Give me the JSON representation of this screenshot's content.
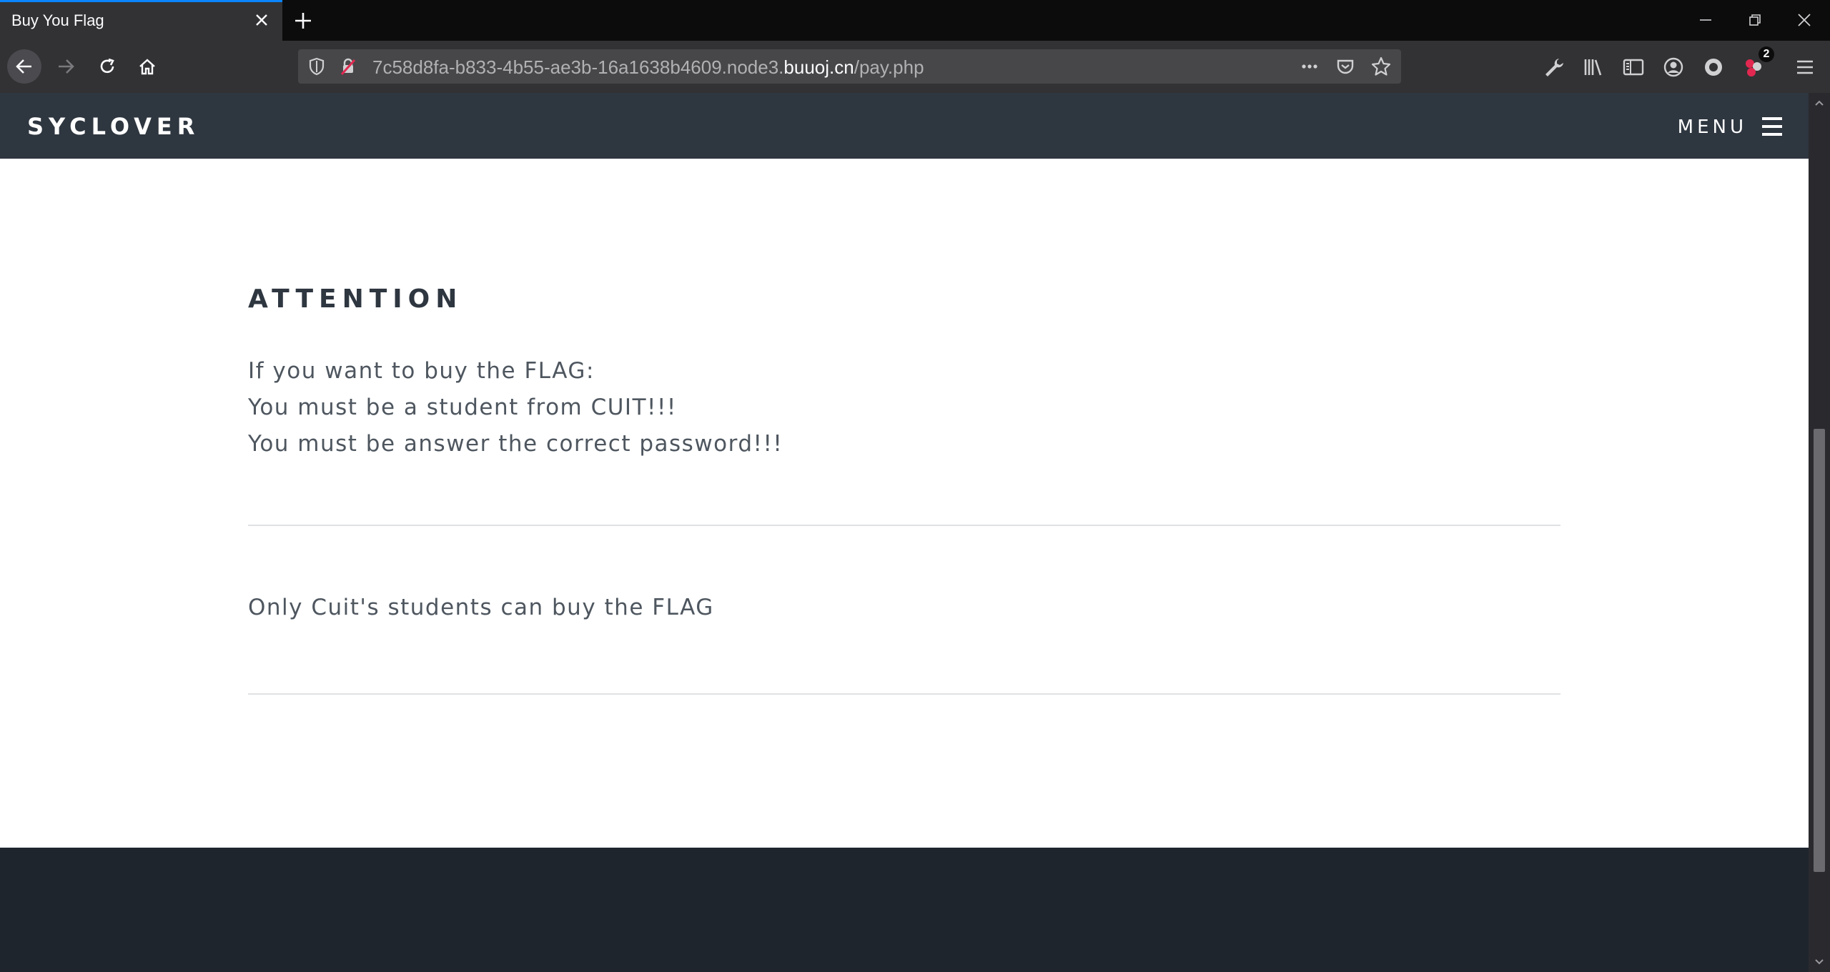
{
  "browser": {
    "tab_title": "Buy You Flag",
    "url": {
      "prefix": "7c58d8fa-b833-4b55-ae3b-16a1638b4609.node3.",
      "domain": "buuoj.cn",
      "path": "/pay.php"
    },
    "notification_badge": "2",
    "accent_color": "#0a84ff",
    "icons": {
      "tab_close": "close-icon",
      "new_tab": "plus-icon",
      "back": "arrow-left-icon",
      "forward": "arrow-right-icon",
      "reload": "reload-icon",
      "home": "home-icon",
      "tracking": "shield-icon",
      "insecure": "lock-slash-icon",
      "page_actions": "ellipsis-icon",
      "pocket": "pocket-icon",
      "bookmark": "star-icon",
      "tools": "wrench-icon",
      "library": "library-icon",
      "sidebar": "sidebar-icon",
      "account": "account-icon",
      "extension_1": "circle-icon",
      "extension_2": "extension-badge-icon",
      "app_menu": "hamburger-icon"
    }
  },
  "site": {
    "brand": "SYCLOVER",
    "menu_label": "MENU",
    "header_color": "#2e3640",
    "footer_color": "#1f252d"
  },
  "attention": {
    "heading": "ATTENTION",
    "lines": [
      "If you want to buy the FLAG:",
      "You must be a student from CUIT!!!",
      "You must be answer the correct password!!!"
    ]
  },
  "message": "Only Cuit's students can buy the FLAG"
}
